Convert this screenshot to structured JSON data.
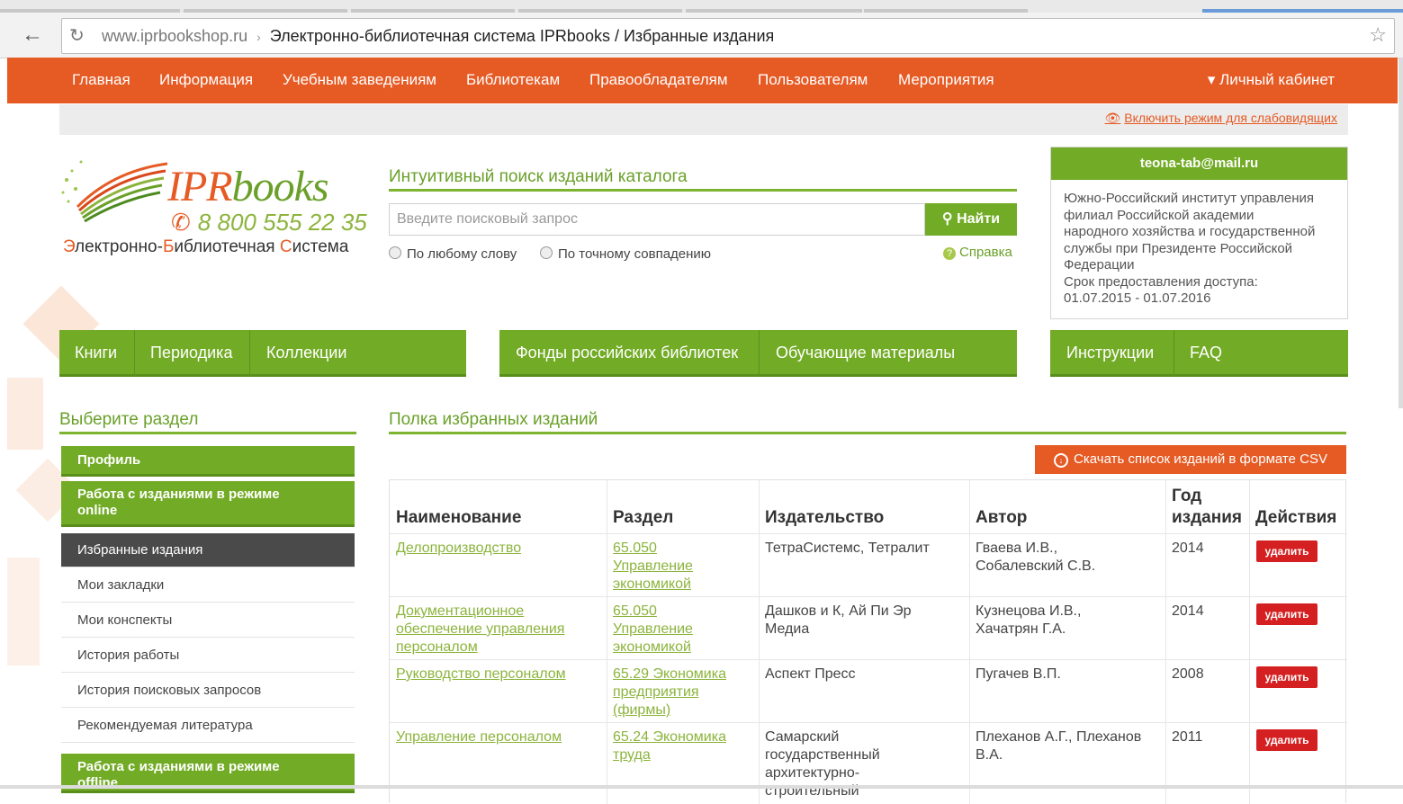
{
  "browser": {
    "host": "www.iprbookshop.ru",
    "separator": "›",
    "page_title": "Электронно-библиотечная система IPRbooks / Избранные издания"
  },
  "topnav": {
    "items": [
      "Главная",
      "Информация",
      "Учебным заведениям",
      "Библиотекам",
      "Правообладателям",
      "Пользователям",
      "Мероприятия"
    ],
    "cabinet": "▾ Личный кабинет"
  },
  "accessibility_link": "Включить режим для слабовидящих",
  "logo": {
    "brand_ipr": "IPR",
    "brand_books": "books",
    "phone": "8 800 555 22 35",
    "tagline_parts": [
      "Э",
      "лектронно-",
      "Б",
      "иблиотечная ",
      "С",
      "истема"
    ]
  },
  "search": {
    "title": "Интуитивный поиск изданий каталога",
    "placeholder": "Введите поисковый запрос",
    "button": "Найти",
    "radio_any": "По любому слову",
    "radio_exact": "По точному совпадению",
    "help": "Справка"
  },
  "user": {
    "email": "teona-tab@mail.ru",
    "org_lines": [
      "Южно-Российский институт управления",
      "филиал Российской академии",
      "народного хозяйства и государственной",
      "службы при Президенте Российской",
      "Федерации",
      "Срок предоставления доступа:",
      "01.07.2015 - 01.07.2016"
    ]
  },
  "tabs": {
    "group1": [
      "Книги",
      "Периодика",
      "Коллекции"
    ],
    "group2": [
      "Фонды российских библиотек",
      "Обучающие материалы"
    ],
    "group3": [
      "Инструкции",
      "FAQ"
    ]
  },
  "sidebar": {
    "title": "Выберите раздел",
    "profile": "Профиль",
    "online_line1": "Работа с изданиями в режиме",
    "online_line2": "online",
    "items": [
      "Избранные издания",
      "Мои закладки",
      "Мои конспекты",
      "История работы",
      "История поисковых запросов",
      "Рекомендуемая литература"
    ],
    "offline_line1": "Работа с изданиями в режиме",
    "offline_line2": "offline"
  },
  "main": {
    "title": "Полка избранных изданий",
    "csv_button": "Скачать список изданий в формате CSV",
    "columns": {
      "name": "Наименование",
      "section": "Раздел",
      "publisher": "Издательство",
      "author": "Автор",
      "year_line1": "Год",
      "year_line2": "издания",
      "actions": "Действия"
    },
    "delete_label": "удалить",
    "rows": [
      {
        "name": [
          "Делопроизводство"
        ],
        "section": [
          "65.050",
          "Управление",
          "экономикой"
        ],
        "publisher": [
          "ТетраСистемс, Тетралит"
        ],
        "author": [
          "Гваева И.В.,",
          "Собалевский С.В."
        ],
        "year": "2014"
      },
      {
        "name": [
          "Документационное",
          "обеспечение управления",
          "персоналом"
        ],
        "section": [
          "65.050",
          "Управление",
          "экономикой"
        ],
        "publisher": [
          "Дашков и К, Ай Пи Эр",
          "Медиа"
        ],
        "author": [
          "Кузнецова И.В.,",
          "Хачатрян Г.А."
        ],
        "year": "2014"
      },
      {
        "name": [
          "Руководство персоналом"
        ],
        "section": [
          "65.29 Экономика",
          "предприятия",
          "(фирмы)"
        ],
        "publisher": [
          "Аспект Пресс"
        ],
        "author": [
          "Пугачев В.П."
        ],
        "year": "2008"
      },
      {
        "name": [
          "Управление персоналом"
        ],
        "section": [
          "65.24 Экономика",
          "труда"
        ],
        "publisher": [
          "Самарский",
          "государственный",
          "архитектурно-",
          "строительный"
        ],
        "author": [
          "Плеханов А.Г., Плеханов",
          "В.А."
        ],
        "year": "2011"
      }
    ]
  },
  "colors": {
    "brand_orange": "#e65a24",
    "brand_green": "#72ab25",
    "link_green": "#8cb43c",
    "delete_red": "#d42020",
    "active_dark": "#4a4a4a"
  }
}
